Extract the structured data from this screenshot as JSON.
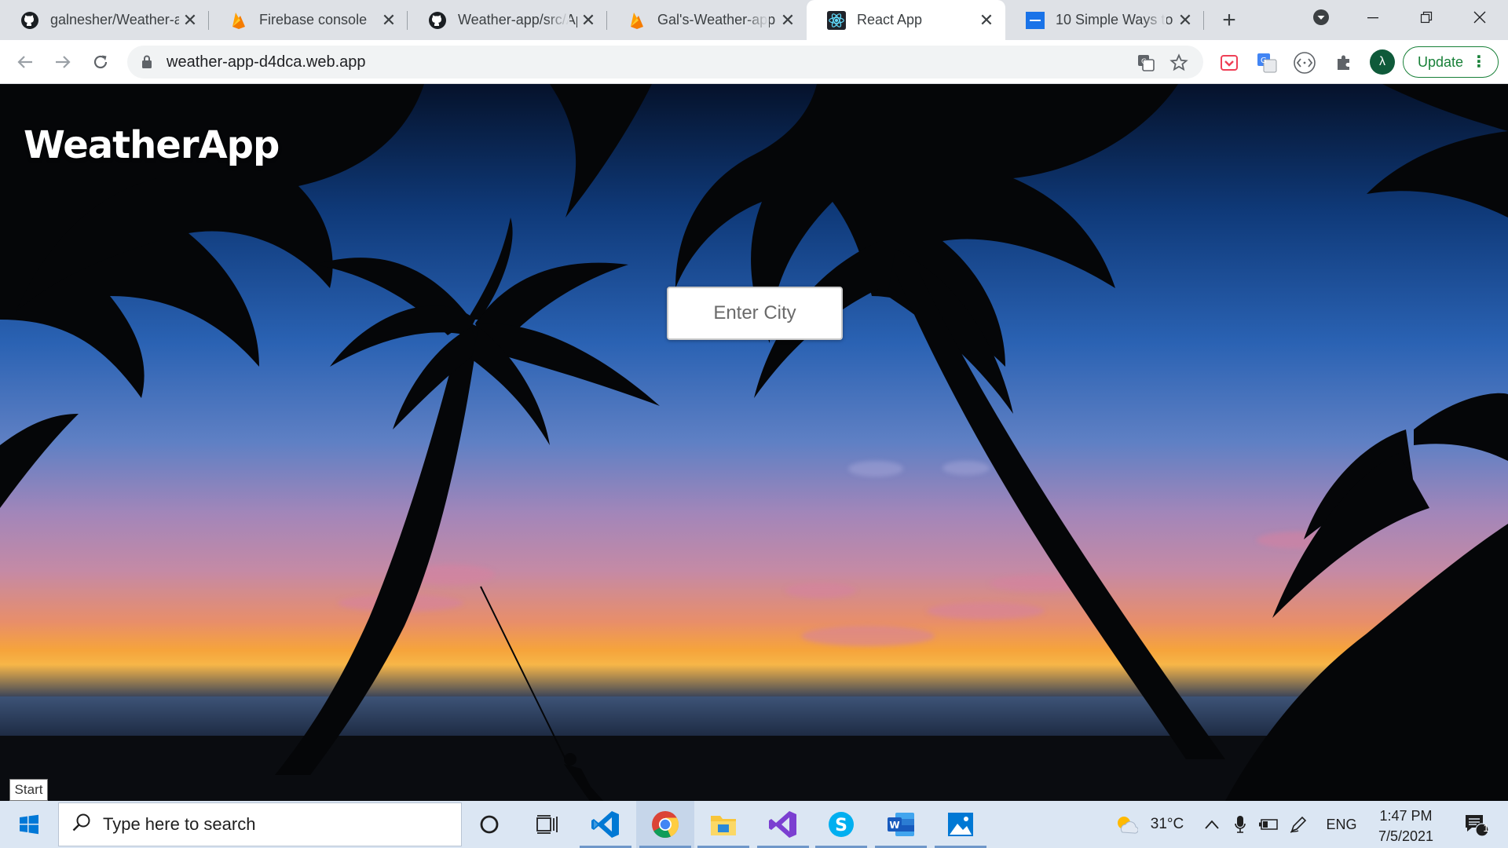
{
  "browser": {
    "tabs": [
      {
        "title": "galnesher/Weather-app",
        "icon": "github-icon"
      },
      {
        "title": "Firebase console",
        "icon": "firebase-icon"
      },
      {
        "title": "Weather-app/src/App.js",
        "icon": "github-icon"
      },
      {
        "title": "Gal's-Weather-app",
        "icon": "firebase-icon"
      },
      {
        "title": "React App",
        "icon": "react-icon",
        "active": true
      },
      {
        "title": "10 Simple Ways to",
        "icon": "article-icon"
      }
    ],
    "new_tab": "+",
    "url": "weather-app-d4dca.web.app",
    "profile_initial": "λ",
    "update_label": "Update"
  },
  "page": {
    "title": "WeatherApp",
    "city_placeholder": "Enter City"
  },
  "tooltip": {
    "start": "Start"
  },
  "taskbar": {
    "search_placeholder": "Type here to search",
    "pinned_apps": [
      "cortana-icon",
      "task-view-icon",
      "vscode-icon",
      "chrome-icon",
      "file-explorer-icon",
      "visual-studio-icon",
      "skype-icon",
      "word-icon",
      "photos-icon"
    ],
    "active_app": "chrome-icon",
    "weather_temp": "31°C",
    "language": "ENG",
    "time": "1:47 PM",
    "date": "7/5/2021",
    "notification_count": "1"
  },
  "colors": {
    "update_green": "#188038",
    "taskbar_bg": "#dbe6f3",
    "tabstrip_bg": "#dee1e6"
  }
}
